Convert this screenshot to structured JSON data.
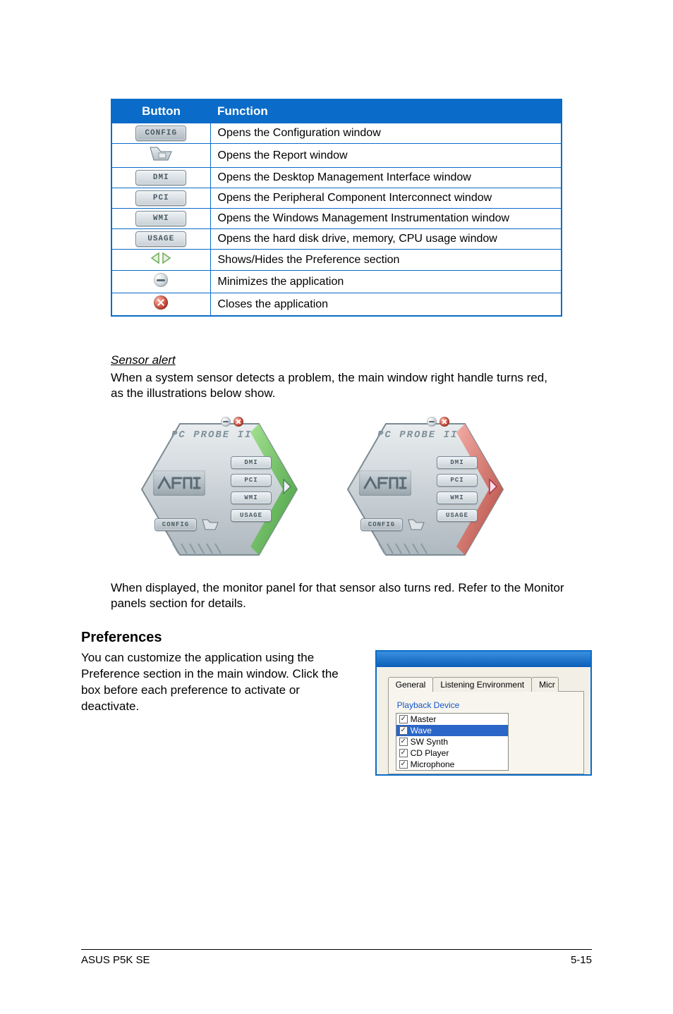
{
  "table": {
    "headers": {
      "button": "Button",
      "function": "Function"
    },
    "rows": [
      {
        "btn": "CONFIG",
        "fn": "Opens the Configuration window"
      },
      {
        "btn": "report-tab-icon",
        "fn": "Opens the Report window"
      },
      {
        "btn": "DMI",
        "fn": "Opens the Desktop Management Interface window"
      },
      {
        "btn": "PCI",
        "fn": "Opens the Peripheral Component Interconnect window"
      },
      {
        "btn": "WMI",
        "fn": "Opens the Windows Management Instrumentation window"
      },
      {
        "btn": "USAGE",
        "fn": "Opens the hard disk drive, memory, CPU usage window"
      },
      {
        "btn": "pref-arrows-icon",
        "fn": "Shows/Hides the Preference section"
      },
      {
        "btn": "minimize-icon",
        "fn": "Minimizes the application"
      },
      {
        "btn": "close-icon",
        "fn": "Closes the application"
      }
    ]
  },
  "sensor": {
    "heading": "Sensor alert",
    "p1": "When a system sensor detects a problem, the main window right handle turns red, as the illustrations below show.",
    "p2": "When displayed, the monitor panel for that sensor also turns red. Refer to the Monitor panels section for details."
  },
  "probe": {
    "title": "PC PROBE II",
    "btns": [
      "DMI",
      "PCI",
      "WMI",
      "USAGE"
    ],
    "config": "CONFIG"
  },
  "preferences": {
    "heading": "Preferences",
    "text": "You can customize the application using the Preference section in the main window. Click the box before each preference to activate or deactivate.",
    "tabs": [
      "General",
      "Listening Environment",
      "Micr"
    ],
    "group": "Playback Device",
    "items": [
      {
        "label": "Master",
        "checked": true,
        "selected": false
      },
      {
        "label": "Wave",
        "checked": true,
        "selected": true
      },
      {
        "label": "SW Synth",
        "checked": true,
        "selected": false
      },
      {
        "label": "CD Player",
        "checked": true,
        "selected": false
      },
      {
        "label": "Microphone",
        "checked": true,
        "selected": false
      }
    ]
  },
  "footer": {
    "left": "ASUS P5K SE",
    "right": "5-15"
  }
}
